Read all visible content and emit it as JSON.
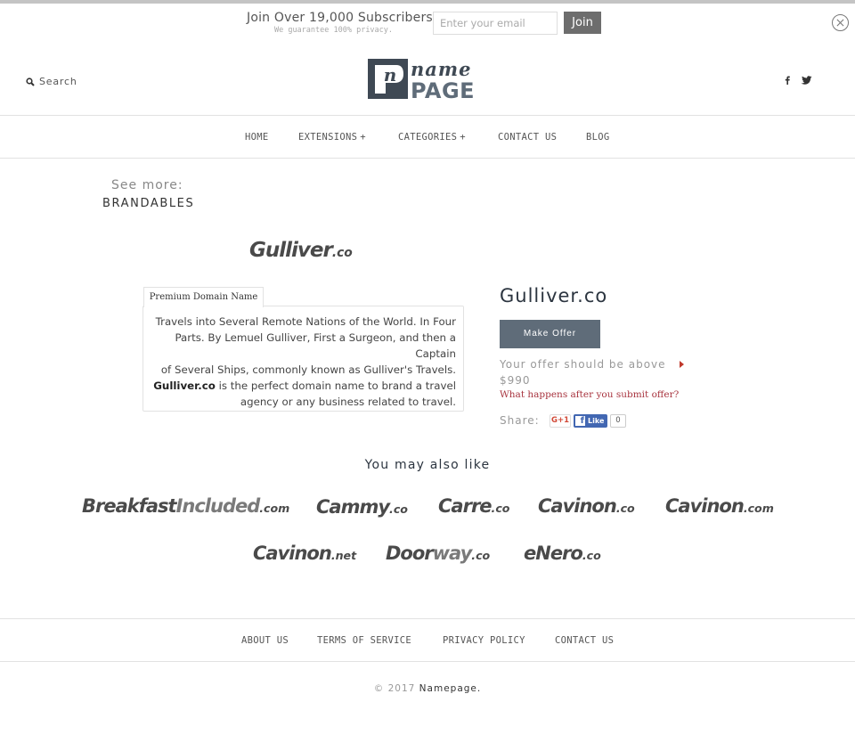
{
  "subscribe": {
    "title": "Join Over 19,000 Subscribers",
    "note": "We guarantee 100% privacy.",
    "email_placeholder": "Enter your email",
    "email_value": "",
    "join_label": "Join",
    "close_icon": "close-circle-icon"
  },
  "header": {
    "search_label": "Search",
    "search_icon": "search-icon",
    "logo": {
      "top": "name",
      "bottom": "PAGE",
      "mark": "n"
    },
    "social_icons": [
      "facebook-icon",
      "twitter-icon"
    ]
  },
  "nav": {
    "items": [
      {
        "label": "HOME",
        "has_submenu": false
      },
      {
        "label": "EXTENSIONS",
        "has_submenu": true,
        "suffix": "+"
      },
      {
        "label": "CATEGORIES",
        "has_submenu": true,
        "suffix": "+"
      },
      {
        "label": "CONTACT US",
        "has_submenu": false
      },
      {
        "label": "BLOG",
        "has_submenu": false
      }
    ]
  },
  "see_more": {
    "label": "See more:",
    "link": "BRANDABLES"
  },
  "product": {
    "logo_name": "Gulliver",
    "logo_tld": ".co",
    "tab_label": "Premium Domain Name",
    "description_lines": [
      "Travels into Several Remote Nations of the World. In Four",
      "Parts. By Lemuel Gulliver, First a Surgeon, and then a Captain",
      "of Several Ships, commonly known as Gulliver's Travels."
    ],
    "description_bold": "Gulliver.co",
    "description_tail_1": " is the perfect domain name to brand a travel",
    "description_tail_2": "agency or any business related to travel.",
    "domain_title": "Gulliver.co",
    "make_offer_label": "Make Offer",
    "offer_hint": "Your offer should be above",
    "offer_min": "$990",
    "what_happens_link": "What happens after you submit offer?",
    "share_label": "Share:",
    "gplus_label": "G+1",
    "fb_like_label": "Like",
    "fb_like_count": "0",
    "colors": {
      "offer_button": "#5f6c79",
      "link_red": "#a8343f"
    }
  },
  "also_like": {
    "title": "You may also like",
    "items": [
      {
        "name": "Breakfast",
        "name_light": "Included",
        "tld": ".com"
      },
      {
        "name": "Cammy",
        "name_light": "",
        "tld": ".co"
      },
      {
        "name": "Carre",
        "name_light": "",
        "tld": ".co"
      },
      {
        "name": "Cavinon",
        "name_light": "",
        "tld": ".co"
      },
      {
        "name": "Cavinon",
        "name_light": "",
        "tld": ".com"
      },
      {
        "name": "Cavinon",
        "name_light": "",
        "tld": ".net"
      },
      {
        "name": "Door",
        "name_light": "way",
        "tld": ".co"
      },
      {
        "name": "eNero",
        "name_light": "",
        "tld": ".co"
      }
    ]
  },
  "footer": {
    "links": [
      "ABOUT US",
      "TERMS OF SERVICE",
      "PRIVACY POLICY",
      "CONTACT US"
    ],
    "copyright_prefix": "© 2017",
    "copyright_brand": "Namepage."
  }
}
